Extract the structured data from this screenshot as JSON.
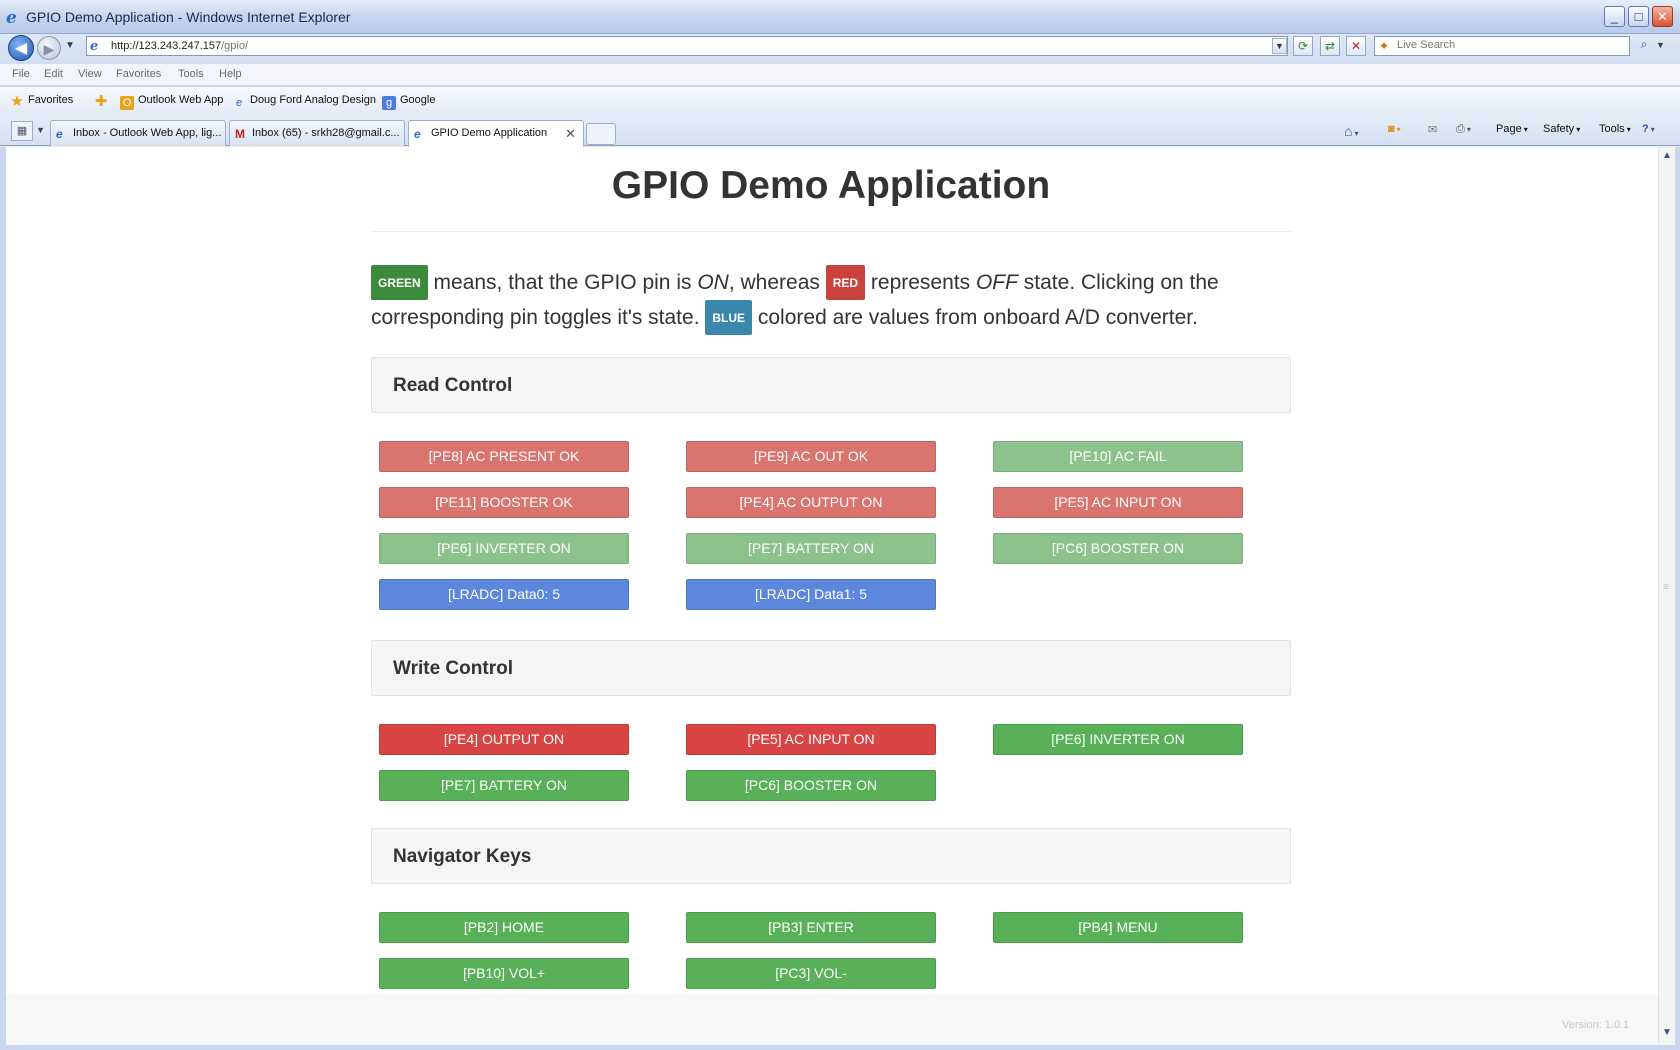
{
  "window": {
    "title": "GPIO Demo Application - Windows Internet Explorer"
  },
  "address": {
    "url_main": "http://123.243.247.157",
    "url_path": "/gpio/"
  },
  "search": {
    "placeholder": "Live Search"
  },
  "menu": [
    "File",
    "Edit",
    "View",
    "Favorites",
    "Tools",
    "Help"
  ],
  "favorites": {
    "label": "Favorites",
    "items": [
      "Outlook Web App",
      "Doug Ford Analog Design",
      "Google"
    ]
  },
  "tabs": [
    {
      "label": "Inbox - Outlook Web App, lig..."
    },
    {
      "label": "Inbox (65) - srkh28@gmail.c..."
    },
    {
      "label": "GPIO Demo Application"
    }
  ],
  "commands": [
    "Page",
    "Safety",
    "Tools"
  ],
  "page": {
    "title": "GPIO Demo Application",
    "intro": {
      "green": "GREEN",
      "t1": " means, that the GPIO pin is ",
      "on": "ON",
      "t2": ", whereas ",
      "red": "RED",
      "t3": " represents ",
      "off": "OFF",
      "t4": " state. Clicking on the corresponding pin toggles it's state. ",
      "blue": "BLUE",
      "t5": " colored are values from onboard A/D converter."
    },
    "sections": {
      "read": "Read Control",
      "write": "Write Control",
      "nav": "Navigator Keys"
    },
    "read_buttons": [
      "[PE8] AC PRESENT OK",
      "[PE9] AC OUT OK",
      "[PE10] AC FAIL",
      "[PE11] BOOSTER OK",
      "[PE4] AC OUTPUT ON",
      "[PE5] AC INPUT ON",
      "[PE6] INVERTER ON",
      "[PE7] BATTERY ON",
      "[PC6] BOOSTER ON",
      "[LRADC] Data0: 5",
      "[LRADC] Data1: 5"
    ],
    "write_buttons": [
      "[PE4] OUTPUT ON",
      "[PE5] AC INPUT ON",
      "[PE6] INVERTER ON",
      "[PE7] BATTERY ON",
      "[PC6] BOOSTER ON"
    ],
    "nav_buttons": [
      "[PB2] HOME",
      "[PB3] ENTER",
      "[PB4] MENU",
      "[PB10] VOL+",
      "[PC3] VOL-"
    ],
    "version": "Version: 1.0.1"
  },
  "colors": {
    "on_green": "#58b158",
    "off_red": "#d94545",
    "adc_blue": "#5c87dd"
  }
}
